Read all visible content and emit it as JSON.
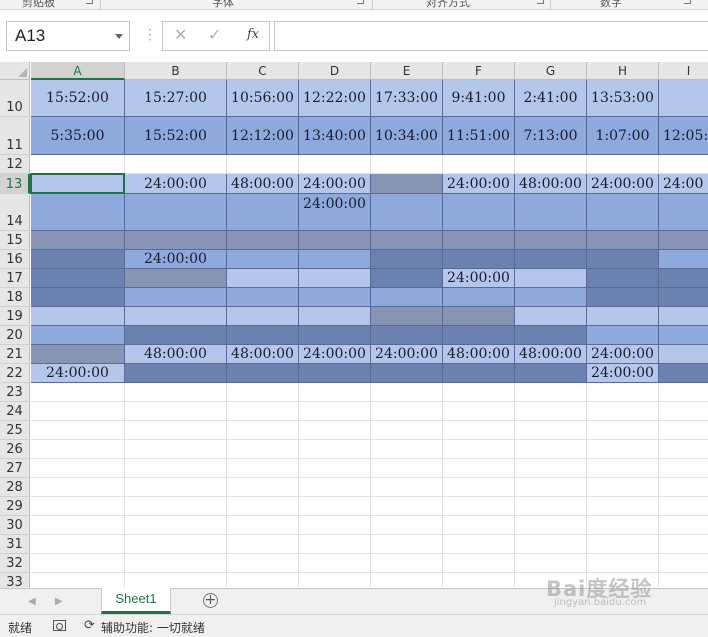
{
  "ribbon": {
    "groups": [
      "剪贴板",
      "字体",
      "对齐方式",
      "数字"
    ]
  },
  "formula_bar": {
    "name_box": "A13",
    "cancel_icon": "✕",
    "enter_icon": "✓",
    "fx_label": "fx",
    "formula": ""
  },
  "sheet": {
    "columns": [
      "A",
      "B",
      "C",
      "D",
      "E",
      "F",
      "G",
      "H",
      "I"
    ],
    "selected_column": "A",
    "selected_row": "13",
    "rows": [
      "10",
      "11",
      "12",
      "13",
      "14",
      "15",
      "16",
      "17",
      "18",
      "19",
      "20",
      "21",
      "22",
      "23",
      "24",
      "25",
      "26",
      "27",
      "28",
      "29",
      "30",
      "31",
      "32",
      "33"
    ],
    "cells": {
      "A10": "15:52:00",
      "B10": "15:27:00",
      "C10": "10:56:00",
      "D10": "12:22:00",
      "E10": "17:33:00",
      "F10": "9:41:00",
      "G10": "2:41:00",
      "H10": "13:53:00",
      "I10": "",
      "A11": "5:35:00",
      "B11": "15:52:00",
      "C11": "12:12:00",
      "D11": "13:40:00",
      "E11": "10:34:00",
      "F11": "11:51:00",
      "G11": "7:13:00",
      "H11": "1:07:00",
      "I11": "12:05:",
      "B13": "24:00:00",
      "C13": "48:00:00",
      "D13": "24:00:00",
      "F13": "24:00:00",
      "G13": "48:00:00",
      "H13": "24:00:00",
      "I13": "24:00",
      "D14": "24:00:00",
      "B16": "24:00:00",
      "F17": "24:00:00",
      "B21": "48:00:00",
      "C21": "48:00:00",
      "D21": "24:00:00",
      "E21": "24:00:00",
      "F21": "48:00:00",
      "G21": "48:00:00",
      "H21": "24:00:00",
      "A22": "24:00:00",
      "H22": "24:00:00"
    }
  },
  "tabs": {
    "sheets": [
      "Sheet1"
    ],
    "add_icon": "+"
  },
  "status_bar": {
    "ready": "就绪",
    "accessibility": "辅助功能: 一切就绪"
  },
  "watermark": {
    "logo": "Bai度经验",
    "url": "jingyan.baidu.com"
  },
  "colors": {
    "accent_green": "#217346",
    "fill_light": "#b4c6ea",
    "fill_mid": "#8ea9db",
    "fill_dark": "#6b82b0",
    "fill_gray": "#8794b4"
  }
}
